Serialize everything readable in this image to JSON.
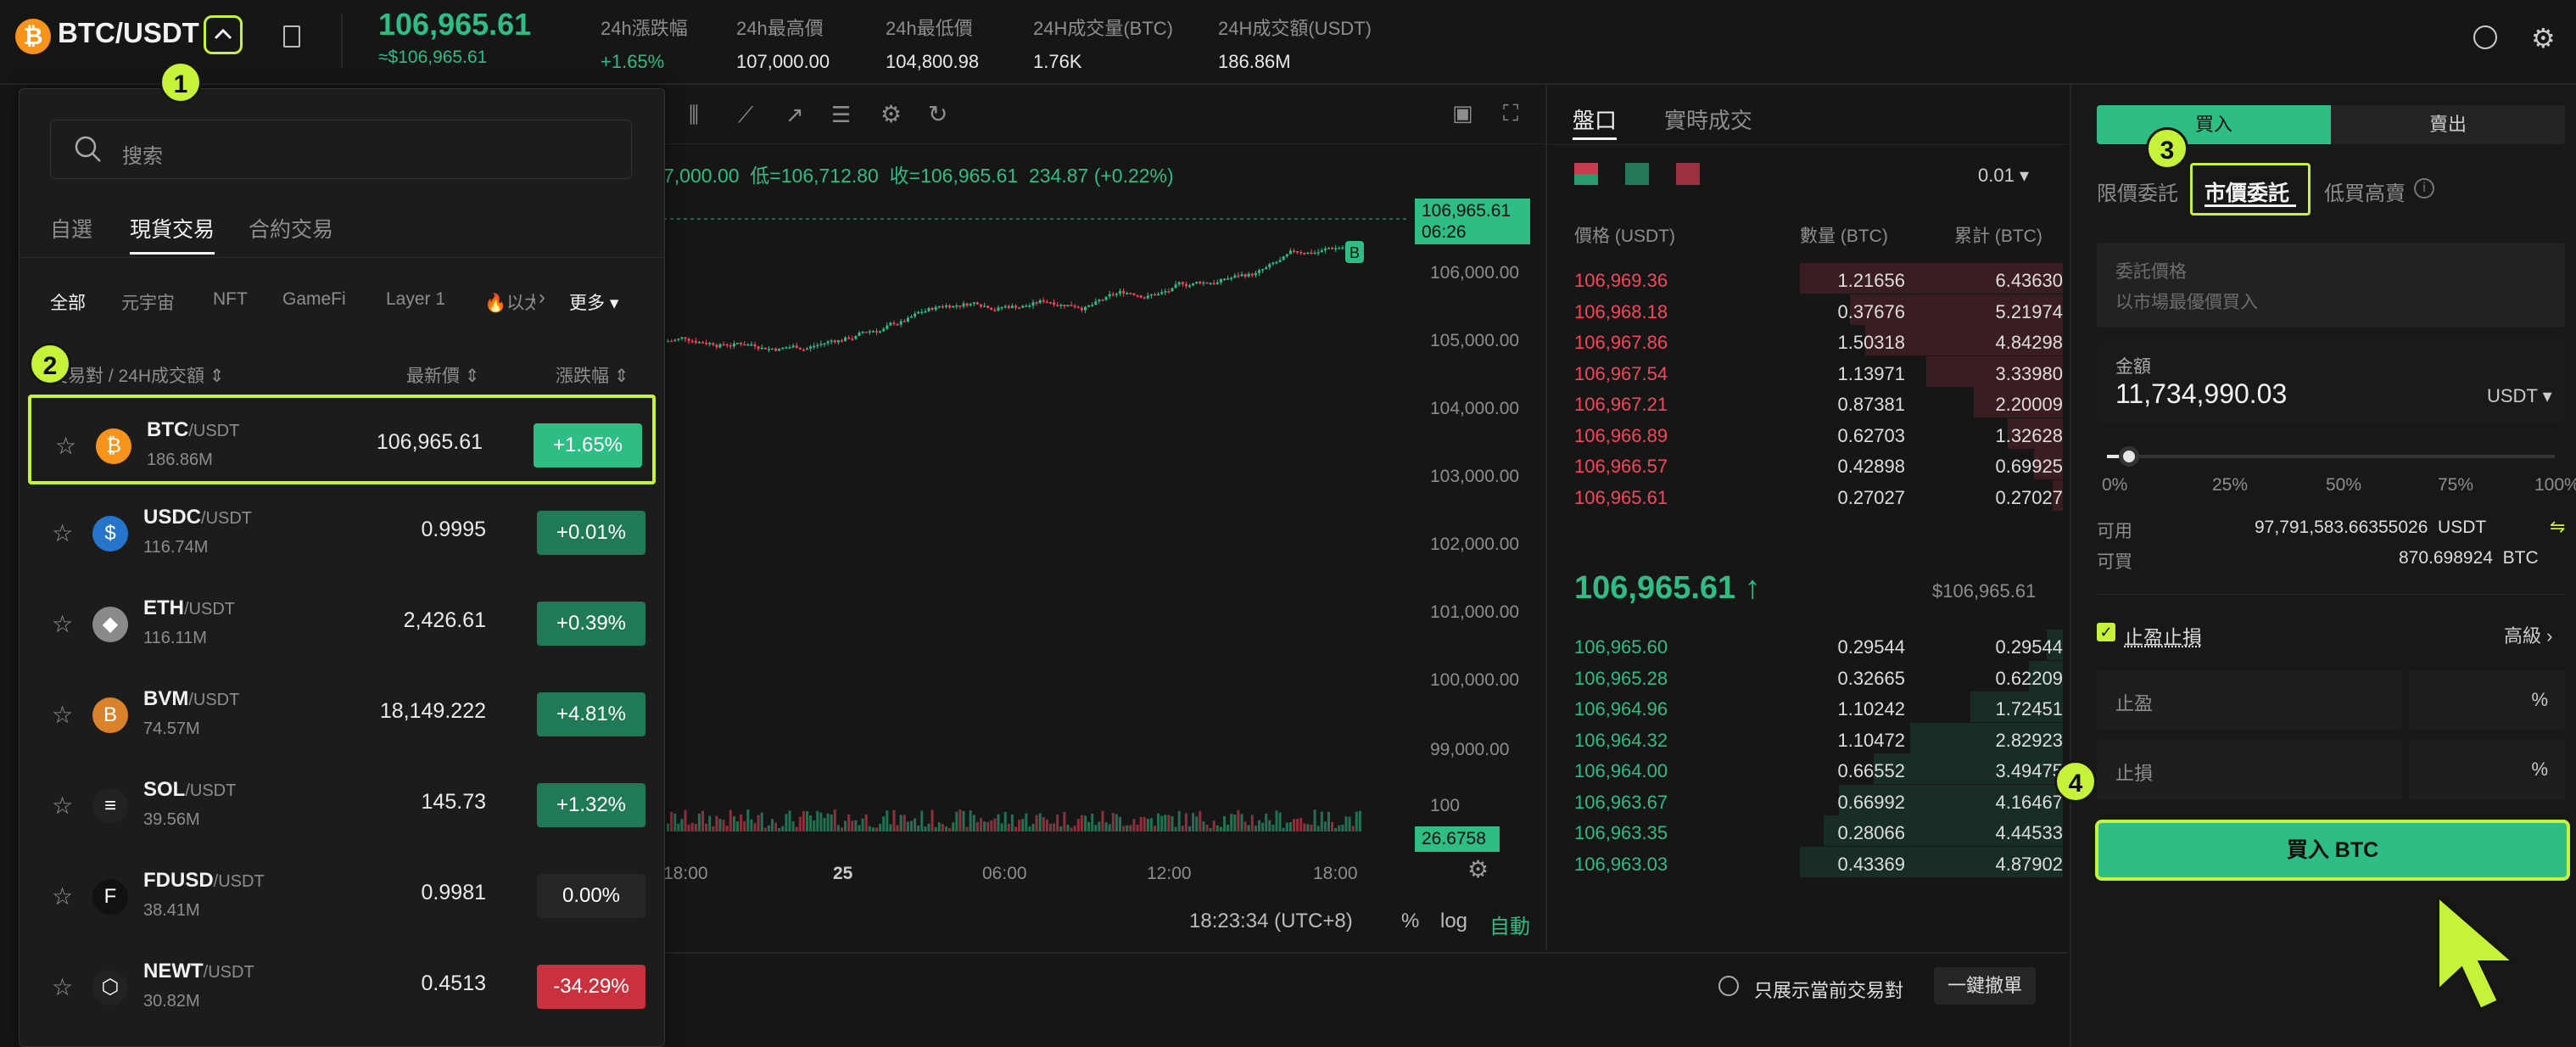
{
  "header": {
    "pair": "BTC/USDT",
    "last_price": "106,965.61",
    "last_price_fiat": "≈$106,965.61",
    "stats": [
      {
        "label": "24h漲跌幅",
        "value": "+1.65%"
      },
      {
        "label": "24h最高價",
        "value": "107,000.00"
      },
      {
        "label": "24h最低價",
        "value": "104,800.98"
      },
      {
        "label": "24H成交量(BTC)",
        "value": "1.76K"
      },
      {
        "label": "24H成交額(USDT)",
        "value": "186.86M"
      }
    ]
  },
  "dropdown": {
    "search_placeholder": "搜索",
    "tabs": [
      "自選",
      "現貨交易",
      "合約交易"
    ],
    "active_tab": "現貨交易",
    "filters": [
      "全部",
      "元宇宙",
      "NFT",
      "GameFi",
      "Layer 1",
      "🔥以太"
    ],
    "more": "更多",
    "col_pair": "交易對 / 24H成交額",
    "col_price": "最新價",
    "col_change": "漲跌幅",
    "rows": [
      {
        "base": "BTC",
        "quote": "/USDT",
        "vol": "186.86M",
        "price": "106,965.61",
        "change": "+1.65%",
        "trend": "up",
        "color": "#f7931a",
        "glyph": "₿"
      },
      {
        "base": "USDC",
        "quote": "/USDT",
        "vol": "116.74M",
        "price": "0.9995",
        "change": "+0.01%",
        "trend": "up",
        "color": "#2775ca",
        "glyph": "$"
      },
      {
        "base": "ETH",
        "quote": "/USDT",
        "vol": "116.11M",
        "price": "2,426.61",
        "change": "+0.39%",
        "trend": "up",
        "color": "#8a8a8a",
        "glyph": "◆"
      },
      {
        "base": "BVM",
        "quote": "/USDT",
        "vol": "74.57M",
        "price": "18,149.222",
        "change": "+4.81%",
        "trend": "up",
        "color": "#d9822b",
        "glyph": "B"
      },
      {
        "base": "SOL",
        "quote": "/USDT",
        "vol": "39.56M",
        "price": "145.73",
        "change": "+1.32%",
        "trend": "up",
        "color": "#222",
        "glyph": "≡"
      },
      {
        "base": "FDUSD",
        "quote": "/USDT",
        "vol": "38.41M",
        "price": "0.9981",
        "change": "0.00%",
        "trend": "flat",
        "color": "#111",
        "glyph": "F"
      },
      {
        "base": "NEWT",
        "quote": "/USDT",
        "vol": "30.82M",
        "price": "0.4513",
        "change": "-34.29%",
        "trend": "down",
        "color": "#222",
        "glyph": "⬡"
      }
    ]
  },
  "chart": {
    "ohlc_text": "7,000.00  低=106,712.80  收=106,965.61  234.87 (+0.22%)",
    "price_tag": "106,965.61",
    "countdown": "06:26",
    "y_ticks": [
      "106,000.00",
      "105,000.00",
      "104,000.00",
      "103,000.00",
      "102,000.00",
      "101,000.00",
      "100,000.00",
      "99,000.00"
    ],
    "vol_tick": "100",
    "vol_tag": "26.6758",
    "x_ticks": [
      "18:00",
      "25",
      "06:00",
      "12:00",
      "18:00"
    ],
    "time": "18:23:34 (UTC+8)",
    "percent": "%",
    "log": "log",
    "auto": "自動",
    "marker": "B"
  },
  "orderbook": {
    "tabs": [
      "盤口",
      "實時成交"
    ],
    "precision": "0.01",
    "col_price": "價格 (USDT)",
    "col_qty": "數量 (BTC)",
    "col_total": "累計 (BTC)",
    "asks": [
      {
        "price": "106,969.36",
        "qty": "1.21656",
        "total": "6.43630",
        "depth": 1.0
      },
      {
        "price": "106,968.18",
        "qty": "0.37676",
        "total": "5.21974",
        "depth": 0.81
      },
      {
        "price": "106,967.86",
        "qty": "1.50318",
        "total": "4.84298",
        "depth": 0.75
      },
      {
        "price": "106,967.54",
        "qty": "1.13971",
        "total": "3.33980",
        "depth": 0.52
      },
      {
        "price": "106,967.21",
        "qty": "0.87381",
        "total": "2.20009",
        "depth": 0.34
      },
      {
        "price": "106,966.89",
        "qty": "0.62703",
        "total": "1.32628",
        "depth": 0.21
      },
      {
        "price": "106,966.57",
        "qty": "0.42898",
        "total": "0.69925",
        "depth": 0.11
      },
      {
        "price": "106,965.61",
        "qty": "0.27027",
        "total": "0.27027",
        "depth": 0.04
      }
    ],
    "mid_price": "106,965.61",
    "mid_fiat": "$106,965.61",
    "bids": [
      {
        "price": "106,965.60",
        "qty": "0.29544",
        "total": "0.29544",
        "depth": 0.06
      },
      {
        "price": "106,965.28",
        "qty": "0.32665",
        "total": "0.62209",
        "depth": 0.13
      },
      {
        "price": "106,964.96",
        "qty": "1.10242",
        "total": "1.72451",
        "depth": 0.35
      },
      {
        "price": "106,964.32",
        "qty": "1.10472",
        "total": "2.82923",
        "depth": 0.58
      },
      {
        "price": "106,964.00",
        "qty": "0.66552",
        "total": "3.49475",
        "depth": 0.72
      },
      {
        "price": "106,963.67",
        "qty": "0.66992",
        "total": "4.16467",
        "depth": 0.85
      },
      {
        "price": "106,963.35",
        "qty": "0.28066",
        "total": "4.44533",
        "depth": 0.91
      },
      {
        "price": "106,963.03",
        "qty": "0.43369",
        "total": "4.87902",
        "depth": 1.0
      }
    ]
  },
  "order": {
    "buy_tab": "買入",
    "sell_tab": "賣出",
    "types": [
      "限價委託",
      "市價委託",
      "低買高賣"
    ],
    "price_label": "委託價格",
    "price_placeholder": "以市場最優價買入",
    "amount_label": "金額",
    "amount_value": "11,734,990.03",
    "amount_unit": "USDT",
    "slider_value": 0.05,
    "slider_marks": [
      "0%",
      "25%",
      "50%",
      "75%",
      "100%"
    ],
    "avail_label": "可用",
    "avail_value": "97,791,583.66355026  USDT",
    "buyable_label": "可買",
    "buyable_value": "870.698924  BTC",
    "tpsl_label": "止盈止損",
    "advanced": "高級",
    "tp_label": "止盈",
    "sl_label": "止損",
    "pct": "%",
    "submit": "買入 BTC"
  },
  "bottom": {
    "only_current": "只展示當前交易對",
    "cancel_all": "一鍵撤單"
  },
  "annotations": [
    "1",
    "2",
    "3",
    "4"
  ],
  "colors": {
    "up": "#2ebd85",
    "down": "#f6465d",
    "accent": "#c7f23a",
    "bg": "#161616"
  }
}
